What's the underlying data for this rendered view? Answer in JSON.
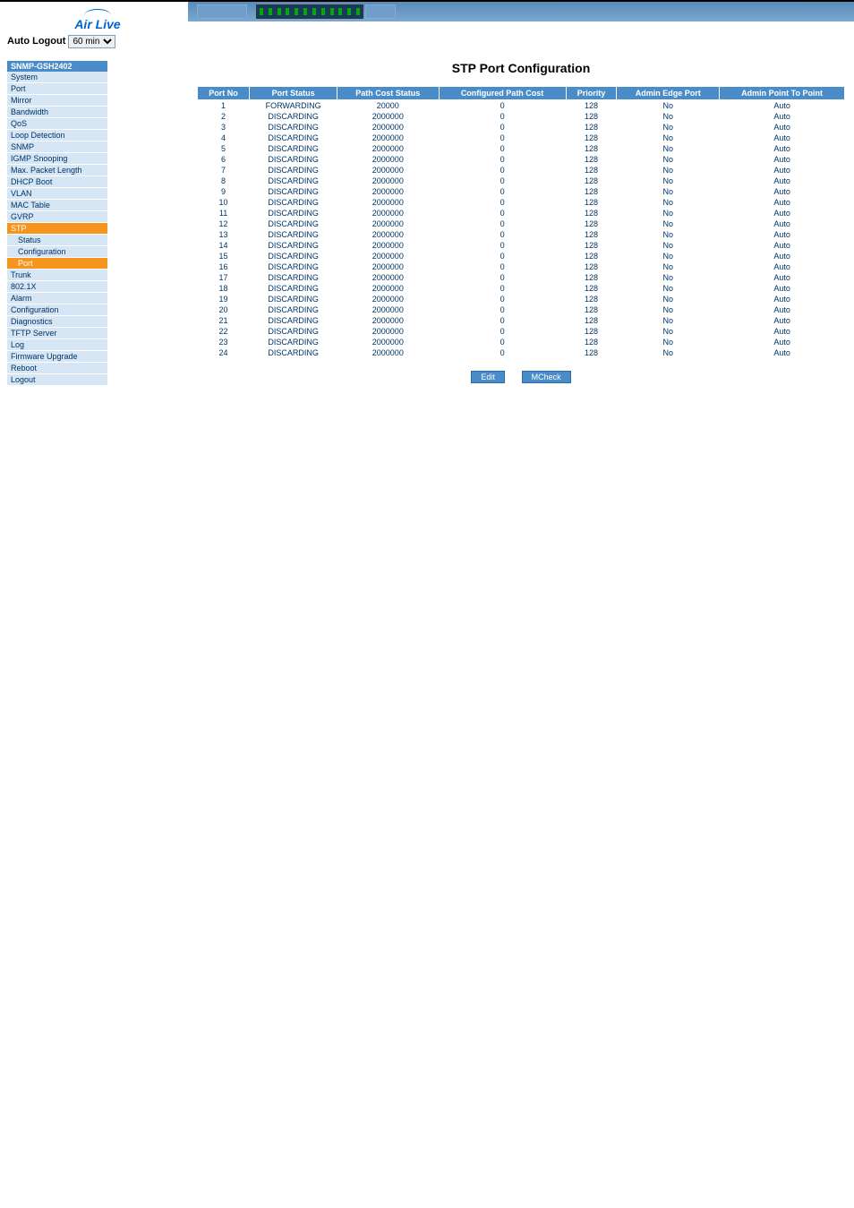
{
  "brand": "Air Live",
  "auto_logout": {
    "label": "Auto Logout",
    "value": "60 min"
  },
  "device_model": "SNMP-GSH2402",
  "nav": [
    {
      "label": "System",
      "type": "item"
    },
    {
      "label": "Port",
      "type": "item"
    },
    {
      "label": "Mirror",
      "type": "item"
    },
    {
      "label": "Bandwidth",
      "type": "item"
    },
    {
      "label": "QoS",
      "type": "item"
    },
    {
      "label": "Loop Detection",
      "type": "item"
    },
    {
      "label": "SNMP",
      "type": "item"
    },
    {
      "label": "IGMP Snooping",
      "type": "item"
    },
    {
      "label": "Max. Packet Length",
      "type": "item"
    },
    {
      "label": "DHCP Boot",
      "type": "item"
    },
    {
      "label": "VLAN",
      "type": "item"
    },
    {
      "label": "MAC Table",
      "type": "item"
    },
    {
      "label": "GVRP",
      "type": "item"
    },
    {
      "label": "STP",
      "type": "active"
    },
    {
      "label": "Status",
      "type": "sub"
    },
    {
      "label": "Configuration",
      "type": "sub"
    },
    {
      "label": "Port",
      "type": "sub-active"
    },
    {
      "label": "Trunk",
      "type": "item"
    },
    {
      "label": "802.1X",
      "type": "item"
    },
    {
      "label": "Alarm",
      "type": "item"
    },
    {
      "label": "Configuration",
      "type": "item"
    },
    {
      "label": "Diagnostics",
      "type": "item"
    },
    {
      "label": "TFTP Server",
      "type": "item"
    },
    {
      "label": "Log",
      "type": "item"
    },
    {
      "label": "Firmware Upgrade",
      "type": "item"
    },
    {
      "label": "Reboot",
      "type": "item"
    },
    {
      "label": "Logout",
      "type": "item"
    }
  ],
  "page_title": "STP Port Configuration",
  "table": {
    "headers": [
      "Port No",
      "Port Status",
      "Path Cost Status",
      "Configured Path Cost",
      "Priority",
      "Admin Edge Port",
      "Admin Point To Point"
    ],
    "rows": [
      {
        "port_no": "1",
        "port_status": "FORWARDING",
        "path_cost_status": "20000",
        "configured_path_cost": "0",
        "priority": "128",
        "admin_edge_port": "No",
        "admin_p2p": "Auto"
      },
      {
        "port_no": "2",
        "port_status": "DISCARDING",
        "path_cost_status": "2000000",
        "configured_path_cost": "0",
        "priority": "128",
        "admin_edge_port": "No",
        "admin_p2p": "Auto"
      },
      {
        "port_no": "3",
        "port_status": "DISCARDING",
        "path_cost_status": "2000000",
        "configured_path_cost": "0",
        "priority": "128",
        "admin_edge_port": "No",
        "admin_p2p": "Auto"
      },
      {
        "port_no": "4",
        "port_status": "DISCARDING",
        "path_cost_status": "2000000",
        "configured_path_cost": "0",
        "priority": "128",
        "admin_edge_port": "No",
        "admin_p2p": "Auto"
      },
      {
        "port_no": "5",
        "port_status": "DISCARDING",
        "path_cost_status": "2000000",
        "configured_path_cost": "0",
        "priority": "128",
        "admin_edge_port": "No",
        "admin_p2p": "Auto"
      },
      {
        "port_no": "6",
        "port_status": "DISCARDING",
        "path_cost_status": "2000000",
        "configured_path_cost": "0",
        "priority": "128",
        "admin_edge_port": "No",
        "admin_p2p": "Auto"
      },
      {
        "port_no": "7",
        "port_status": "DISCARDING",
        "path_cost_status": "2000000",
        "configured_path_cost": "0",
        "priority": "128",
        "admin_edge_port": "No",
        "admin_p2p": "Auto"
      },
      {
        "port_no": "8",
        "port_status": "DISCARDING",
        "path_cost_status": "2000000",
        "configured_path_cost": "0",
        "priority": "128",
        "admin_edge_port": "No",
        "admin_p2p": "Auto"
      },
      {
        "port_no": "9",
        "port_status": "DISCARDING",
        "path_cost_status": "2000000",
        "configured_path_cost": "0",
        "priority": "128",
        "admin_edge_port": "No",
        "admin_p2p": "Auto"
      },
      {
        "port_no": "10",
        "port_status": "DISCARDING",
        "path_cost_status": "2000000",
        "configured_path_cost": "0",
        "priority": "128",
        "admin_edge_port": "No",
        "admin_p2p": "Auto"
      },
      {
        "port_no": "11",
        "port_status": "DISCARDING",
        "path_cost_status": "2000000",
        "configured_path_cost": "0",
        "priority": "128",
        "admin_edge_port": "No",
        "admin_p2p": "Auto"
      },
      {
        "port_no": "12",
        "port_status": "DISCARDING",
        "path_cost_status": "2000000",
        "configured_path_cost": "0",
        "priority": "128",
        "admin_edge_port": "No",
        "admin_p2p": "Auto"
      },
      {
        "port_no": "13",
        "port_status": "DISCARDING",
        "path_cost_status": "2000000",
        "configured_path_cost": "0",
        "priority": "128",
        "admin_edge_port": "No",
        "admin_p2p": "Auto"
      },
      {
        "port_no": "14",
        "port_status": "DISCARDING",
        "path_cost_status": "2000000",
        "configured_path_cost": "0",
        "priority": "128",
        "admin_edge_port": "No",
        "admin_p2p": "Auto"
      },
      {
        "port_no": "15",
        "port_status": "DISCARDING",
        "path_cost_status": "2000000",
        "configured_path_cost": "0",
        "priority": "128",
        "admin_edge_port": "No",
        "admin_p2p": "Auto"
      },
      {
        "port_no": "16",
        "port_status": "DISCARDING",
        "path_cost_status": "2000000",
        "configured_path_cost": "0",
        "priority": "128",
        "admin_edge_port": "No",
        "admin_p2p": "Auto"
      },
      {
        "port_no": "17",
        "port_status": "DISCARDING",
        "path_cost_status": "2000000",
        "configured_path_cost": "0",
        "priority": "128",
        "admin_edge_port": "No",
        "admin_p2p": "Auto"
      },
      {
        "port_no": "18",
        "port_status": "DISCARDING",
        "path_cost_status": "2000000",
        "configured_path_cost": "0",
        "priority": "128",
        "admin_edge_port": "No",
        "admin_p2p": "Auto"
      },
      {
        "port_no": "19",
        "port_status": "DISCARDING",
        "path_cost_status": "2000000",
        "configured_path_cost": "0",
        "priority": "128",
        "admin_edge_port": "No",
        "admin_p2p": "Auto"
      },
      {
        "port_no": "20",
        "port_status": "DISCARDING",
        "path_cost_status": "2000000",
        "configured_path_cost": "0",
        "priority": "128",
        "admin_edge_port": "No",
        "admin_p2p": "Auto"
      },
      {
        "port_no": "21",
        "port_status": "DISCARDING",
        "path_cost_status": "2000000",
        "configured_path_cost": "0",
        "priority": "128",
        "admin_edge_port": "No",
        "admin_p2p": "Auto"
      },
      {
        "port_no": "22",
        "port_status": "DISCARDING",
        "path_cost_status": "2000000",
        "configured_path_cost": "0",
        "priority": "128",
        "admin_edge_port": "No",
        "admin_p2p": "Auto"
      },
      {
        "port_no": "23",
        "port_status": "DISCARDING",
        "path_cost_status": "2000000",
        "configured_path_cost": "0",
        "priority": "128",
        "admin_edge_port": "No",
        "admin_p2p": "Auto"
      },
      {
        "port_no": "24",
        "port_status": "DISCARDING",
        "path_cost_status": "2000000",
        "configured_path_cost": "0",
        "priority": "128",
        "admin_edge_port": "No",
        "admin_p2p": "Auto"
      }
    ]
  },
  "buttons": {
    "edit": "Edit",
    "mcheck": "MCheck"
  }
}
